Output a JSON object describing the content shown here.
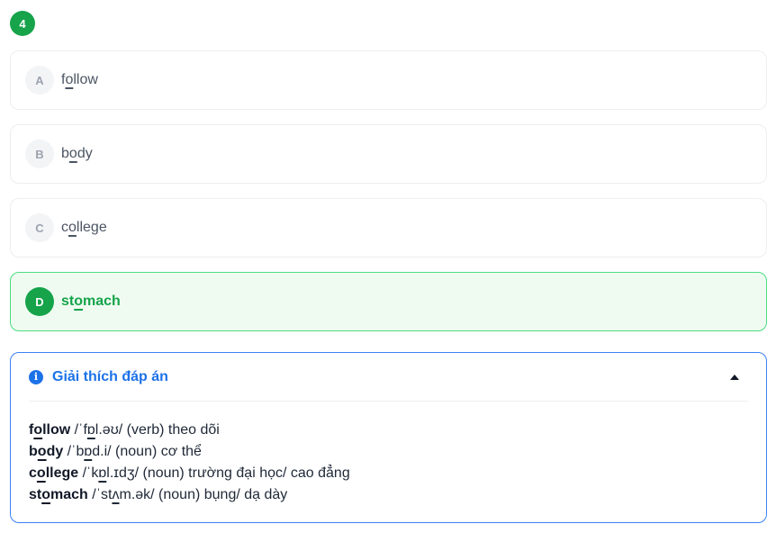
{
  "question": {
    "number": "4"
  },
  "options": [
    {
      "letter": "A",
      "pre": "f",
      "mid": "o",
      "post": "llow"
    },
    {
      "letter": "B",
      "pre": "b",
      "mid": "o",
      "post": "dy"
    },
    {
      "letter": "C",
      "pre": "c",
      "mid": "o",
      "post": "llege"
    },
    {
      "letter": "D",
      "pre": "st",
      "mid": "o",
      "post": "mach"
    }
  ],
  "explanation": {
    "title": "Giải thích đáp án",
    "lines": [
      {
        "w_pre": "f",
        "w_mid": "o",
        "w_post": "llow",
        "p_pre": " /ˈf",
        "p_mid": "ɒ",
        "p_post": "l.əʊ/ (verb) theo dõi"
      },
      {
        "w_pre": "b",
        "w_mid": "o",
        "w_post": "dy",
        "p_pre": " /ˈb",
        "p_mid": "ɒ",
        "p_post": "d.i/ (noun) cơ thể"
      },
      {
        "w_pre": "c",
        "w_mid": "o",
        "w_post": "llege",
        "p_pre": " /ˈk",
        "p_mid": "ɒ",
        "p_post": "l.ɪdʒ/ (noun) trường đại học/ cao đẳng"
      },
      {
        "w_pre": "st",
        "w_mid": "o",
        "w_post": "mach",
        "p_pre": " /ˈst",
        "p_mid": "ʌ",
        "p_post": "m.ək/ (noun) bụng/ dạ dày"
      }
    ]
  },
  "colors": {
    "accent_green": "#16a34a",
    "accent_blue": "#1d72e8"
  },
  "icons": {
    "info": "info-circle-icon",
    "collapse": "caret-up-icon"
  }
}
